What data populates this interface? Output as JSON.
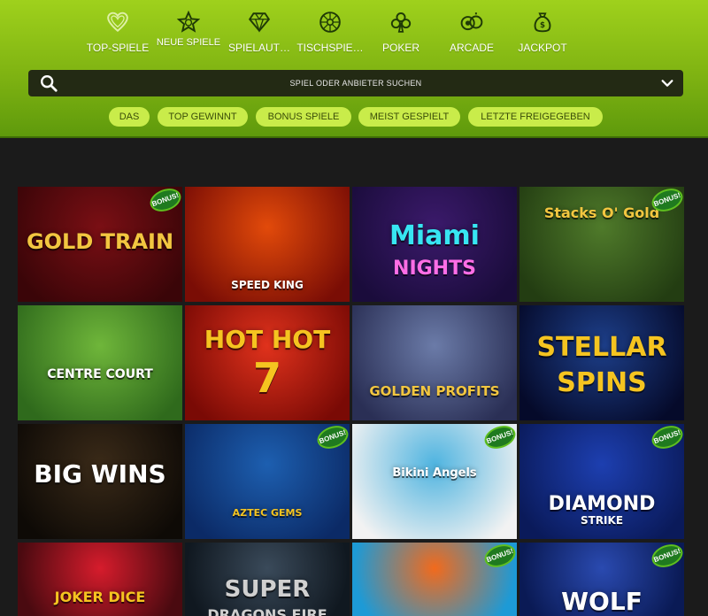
{
  "categories": [
    {
      "label": "TOP-SPIELE",
      "icon": "heart-icon"
    },
    {
      "label": "NEUE SPIELE",
      "icon": "star-icon"
    },
    {
      "label": "SPIELAUT…",
      "icon": "diamond-icon"
    },
    {
      "label": "TISCHSPIE…",
      "icon": "roulette-icon"
    },
    {
      "label": "POKER",
      "icon": "club-icon"
    },
    {
      "label": "ARCADE",
      "icon": "arcade-icon"
    },
    {
      "label": "JACKPOT",
      "icon": "money-bag-icon"
    }
  ],
  "search": {
    "placeholder": "SPIEL ODER ANBIETER SUCHEN",
    "icon": "search-icon",
    "toggle_icon": "chevron-down-icon"
  },
  "filters": [
    "DAS",
    "TOP GEWINNT",
    "BONUS SPIELE",
    "MEIST GESPIELT",
    "LETZTE FREIGEGEBEN"
  ],
  "badge_label": "BONUS!",
  "games": [
    {
      "title": "GOLD TRAIN",
      "bonus": true,
      "bg1": "#7a0f14",
      "bg2": "#3a0508",
      "fg": "#f2c640"
    },
    {
      "title": "SPEED KING",
      "bonus": false,
      "bg1": "#e24a0a",
      "bg2": "#7a0d05",
      "fg": "#ffffff"
    },
    {
      "title": "Miami",
      "subtitle": "NIGHTS",
      "bonus": false,
      "bg1": "#3b1a6b",
      "bg2": "#1a0c3b",
      "fg": "#37e6f2"
    },
    {
      "title": "Stacks O' Gold",
      "bonus": true,
      "bg1": "#4f7a2a",
      "bg2": "#233d12",
      "fg": "#f2c640"
    },
    {
      "title": "CENTRE COURT",
      "bonus": false,
      "bg1": "#6fb63a",
      "bg2": "#2f6a1c",
      "fg": "#ffffff"
    },
    {
      "title": "HOT HOT",
      "subtitle": "7",
      "bonus": false,
      "bg1": "#e0321c",
      "bg2": "#7a0a05",
      "fg": "#f5c420"
    },
    {
      "title": "GOLDEN PROFITS",
      "bonus": false,
      "bg1": "#6b7ba8",
      "bg2": "#2a2f55",
      "fg": "#f2c640"
    },
    {
      "title": "STELLAR",
      "subtitle": "SPINS",
      "bonus": false,
      "bg1": "#1d3f8a",
      "bg2": "#050a2a",
      "fg": "#f5c420"
    },
    {
      "title": "BIG WINS",
      "bonus": false,
      "bg1": "#3a2a18",
      "bg2": "#0e0a06",
      "fg": "#ffffff"
    },
    {
      "title": "AZTEC GEMS",
      "bonus": true,
      "bg1": "#1d5fb0",
      "bg2": "#0b2a66",
      "fg": "#f5c420"
    },
    {
      "title": "Bikini Angels",
      "bonus": true,
      "bg1": "#4fb4e0",
      "bg2": "#f2f2f2",
      "fg": "#ffffff"
    },
    {
      "title": "DIAMOND",
      "subtitle": "STRIKE",
      "bonus": true,
      "bg1": "#1d3fb0",
      "bg2": "#0a1a5a",
      "fg": "#ffffff"
    },
    {
      "title": "JOKER DICE",
      "bonus": false,
      "bg1": "#d61c2c",
      "bg2": "#4a0a10",
      "fg": "#f5c420"
    },
    {
      "title": "SUPER",
      "subtitle": "DRAGONS FIRE",
      "bonus": false,
      "bg1": "#3a4a5a",
      "bg2": "#101820",
      "fg": "#d0d0d0"
    },
    {
      "title": "",
      "bonus": true,
      "bg1": "#f26a1c",
      "bg2": "#1d9ad6",
      "fg": "#ffffff"
    },
    {
      "title": "WOLF",
      "bonus": true,
      "bg1": "#2a4ab0",
      "bg2": "#0a1a55",
      "fg": "#ffffff"
    }
  ]
}
